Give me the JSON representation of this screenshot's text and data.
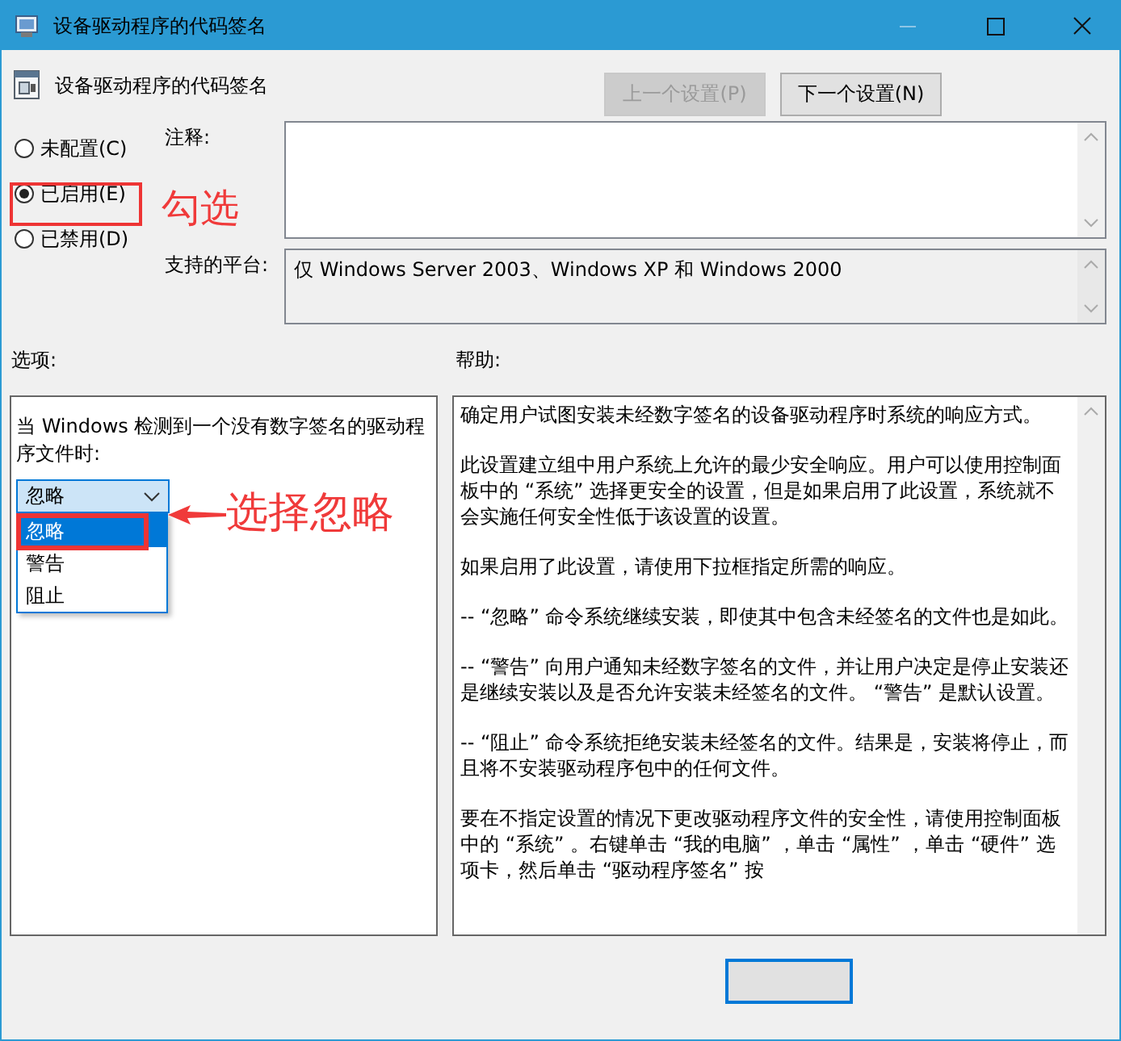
{
  "window": {
    "title": "设备驱动程序的代码签名"
  },
  "header": {
    "title": "设备驱动程序的代码签名",
    "buttons": [
      {
        "label": "上一个设置(P)",
        "disabled": true
      },
      {
        "label": "下一个设置(N)",
        "disabled": false
      }
    ]
  },
  "state_options": [
    {
      "label": "未配置(C)",
      "selected": false
    },
    {
      "label": "已启用(E)",
      "selected": true
    },
    {
      "label": "已禁用(D)",
      "selected": false
    }
  ],
  "comment": {
    "label": "注释:"
  },
  "platform": {
    "label": "支持的平台:",
    "value": "仅 Windows Server 2003、Windows XP 和 Windows 2000"
  },
  "options": {
    "label": "选项:",
    "prompt": "当 Windows 检测到一个没有数字签名的驱动程序文件时:",
    "dropdown": {
      "value": "忽略",
      "expanded": true,
      "items": [
        {
          "label": "忽略",
          "selected": true
        },
        {
          "label": "警告",
          "selected": false
        },
        {
          "label": "阻止",
          "selected": false
        }
      ]
    }
  },
  "help": {
    "label": "帮助:",
    "paragraphs": [
      "确定用户试图安装未经数字签名的设备驱动程序时系统的响应方式。",
      "此设置建立组中用户系统上允许的最少安全响应。用户可以使用控制面板中的 “系统” 选择更安全的设置，但是如果启用了此设置，系统就不会实施任何安全性低于该设置的设置。",
      "如果启用了此设置，请使用下拉框指定所需的响应。",
      "-- “忽略” 命令系统继续安装，即使其中包含未经签名的文件也是如此。",
      "-- “警告” 向用户通知未经数字签名的文件，并让用户决定是停止安装还是继续安装以及是否允许安装未经签名的文件。 “警告” 是默认设置。",
      "-- “阻止” 命令系统拒绝安装未经签名的文件。结果是，安装将停止，而且将不安装驱动程序包中的任何文件。",
      "要在不指定设置的情况下更改驱动程序文件的安全性，请使用控制面板中的 “系统” 。右键单击 “我的电脑” ，单击 “属性” ，单击 “硬件” 选项卡，然后单击 “驱动程序签名” 按"
    ]
  },
  "annotations": [
    {
      "text": "勾选"
    },
    {
      "text": "选择忽略"
    }
  ]
}
